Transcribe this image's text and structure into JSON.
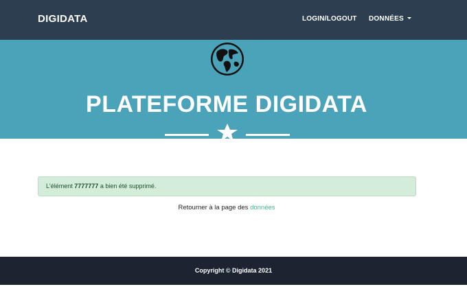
{
  "navbar": {
    "brand": "DIGIDATA",
    "login_label": "LOGIN/LOGOUT",
    "data_label": "DONNÉES"
  },
  "masthead": {
    "icon": "globe-icon",
    "title": "PLATEFORME DIGIDATA",
    "divider_icon": "star-icon",
    "background": "#4aa3b8"
  },
  "alert": {
    "prefix": "L'élément",
    "item_id": "7777777",
    "suffix": "a bien été supprimé."
  },
  "return_link": {
    "text": "Retourner à la page des",
    "link_text": "données"
  },
  "footer": {
    "text": "Copyright © Digidata 2021"
  },
  "colors": {
    "navbar": "#2c3e50",
    "accent_link": "#3fb58c",
    "alert_bg": "#d4edda",
    "footer": "#1b2430"
  }
}
